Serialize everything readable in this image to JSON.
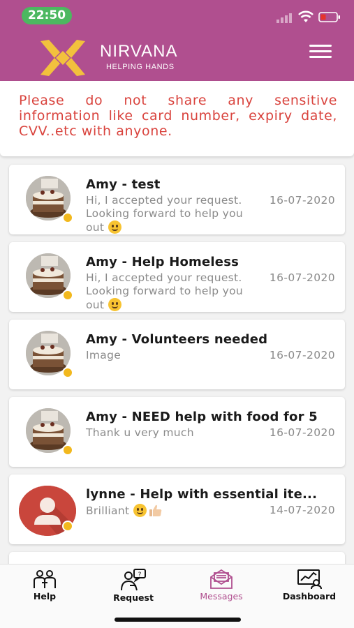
{
  "status_bar": {
    "time": "22:50"
  },
  "brand": {
    "name": "NIRVANA",
    "tagline": "HELPING HANDS"
  },
  "warning": {
    "text": "Please do not share any sensitive information like card number, expiry date, CVV..etc with anyone."
  },
  "messages": [
    {
      "title": "Amy - test",
      "preview": "Hi, I accepted your request. Looking forward to help you out",
      "date": "16-07-2020",
      "avatar": "cake-photo",
      "emojis": [
        "smile"
      ]
    },
    {
      "title": "Amy - Help Homeless",
      "preview": "Hi, I accepted your request. Looking forward to help you out",
      "date": "16-07-2020",
      "avatar": "cake-photo",
      "emojis": [
        "smile"
      ]
    },
    {
      "title": "Amy - Volunteers needed",
      "preview": "Image",
      "date": "16-07-2020",
      "avatar": "cake-photo",
      "emojis": []
    },
    {
      "title": "Amy - NEED help with food for 5",
      "preview": "Thank u very much",
      "date": "16-07-2020",
      "avatar": "cake-photo",
      "emojis": []
    },
    {
      "title": "lynne - Help with essential ite...",
      "preview": "Brilliant",
      "date": "14-07-2020",
      "avatar": "default-person",
      "emojis": [
        "smile",
        "thumbs-up"
      ]
    }
  ],
  "nav": [
    {
      "label": "Help",
      "icon": "people-icon",
      "active": false
    },
    {
      "label": "Request",
      "icon": "request-icon",
      "active": false
    },
    {
      "label": "Messages",
      "icon": "envelope-icon",
      "active": true
    },
    {
      "label": "Dashboard",
      "icon": "dashboard-icon",
      "active": false
    }
  ],
  "colors": {
    "header": "#b04f8f",
    "warning_text": "#d9433d",
    "status_dot": "#f2b81d",
    "active_nav": "#b04f8f"
  }
}
